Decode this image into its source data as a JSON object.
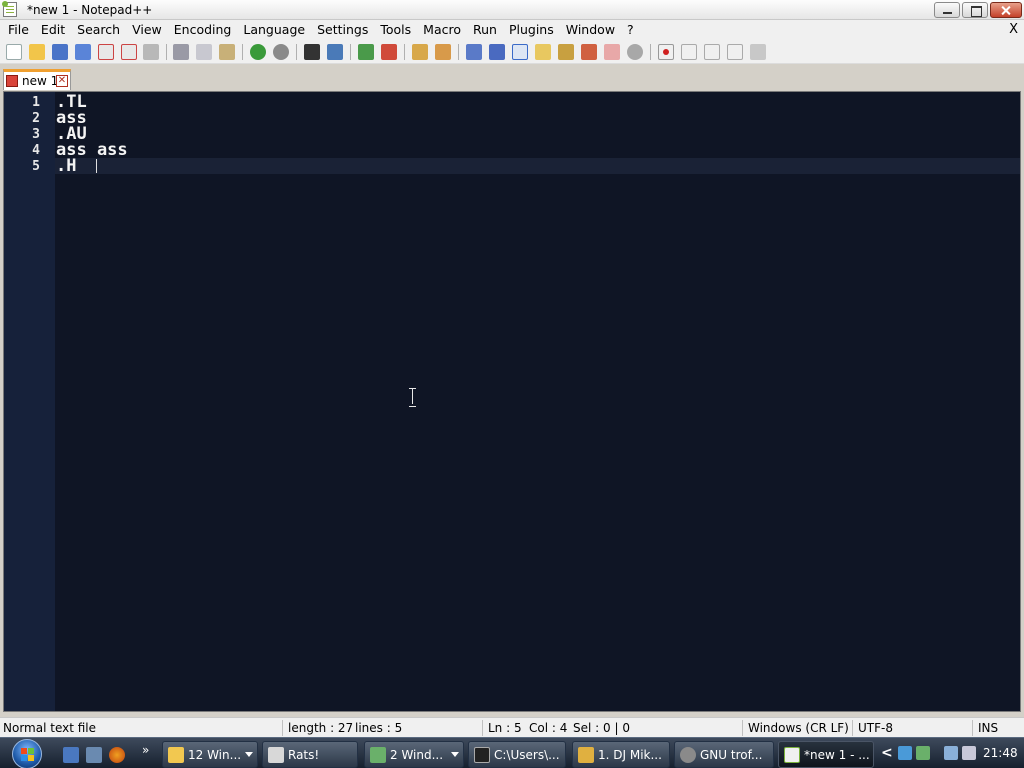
{
  "window": {
    "title": "*new 1 - Notepad++",
    "icon": "notepad-plus-plus-icon"
  },
  "menu": {
    "items": [
      "File",
      "Edit",
      "Search",
      "View",
      "Encoding",
      "Language",
      "Settings",
      "Tools",
      "Macro",
      "Run",
      "Plugins",
      "Window",
      "?"
    ],
    "close_label": "X"
  },
  "toolbar": {
    "icons": [
      "new-file-icon",
      "open-file-icon",
      "save-icon",
      "save-all-icon",
      "close-icon",
      "close-all-icon",
      "print-icon",
      "cut-icon",
      "copy-icon",
      "paste-icon",
      "undo-icon",
      "redo-icon",
      "find-icon",
      "replace-icon",
      "zoom-in-icon",
      "zoom-out-icon",
      "sync-vertical-icon",
      "sync-horizontal-icon",
      "word-wrap-icon",
      "show-all-chars-icon",
      "indent-guide-icon",
      "user-language-icon",
      "doc-map-icon",
      "function-list-icon",
      "folder-workspace-icon",
      "monitoring-icon",
      "record-macro-icon",
      "stop-macro-icon",
      "play-macro-icon",
      "run-macro-multiple-icon",
      "save-macro-icon"
    ]
  },
  "tab": {
    "label": "new 1",
    "close_label": "✕"
  },
  "editor": {
    "line_numbers": [
      "1",
      "2",
      "3",
      "4",
      "5"
    ],
    "lines": [
      ".TL",
      "ass",
      ".AU",
      "ass ass",
      ".H "
    ],
    "current_line": 5
  },
  "status": {
    "filetype": "Normal text file",
    "length": "length : 27",
    "lines": "lines : 5",
    "ln": "Ln : 5",
    "col": "Col : 4",
    "sel": "Sel : 0 | 0",
    "eol": "Windows (CR LF)",
    "encoding": "UTF-8",
    "mode": "INS"
  },
  "taskbar": {
    "more_label": "»",
    "tasks": [
      {
        "label": "12 Win...",
        "icon": "folder-icon",
        "has_menu": true
      },
      {
        "label": "Rats!",
        "icon": "rats-app-icon",
        "has_menu": false
      },
      {
        "label": "2 Wind...",
        "icon": "network-icon",
        "has_menu": true
      },
      {
        "label": "C:\\Users\\...",
        "icon": "cmd-icon",
        "has_menu": false
      },
      {
        "label": "1. DJ Mik...",
        "icon": "music-icon",
        "has_menu": false
      },
      {
        "label": "GNU trof...",
        "icon": "gnu-icon",
        "has_menu": false
      },
      {
        "label": "*new 1 - ...",
        "icon": "notepad-plus-plus-icon",
        "has_menu": false
      }
    ],
    "tray_arrow": "<",
    "clock": "21:48"
  }
}
